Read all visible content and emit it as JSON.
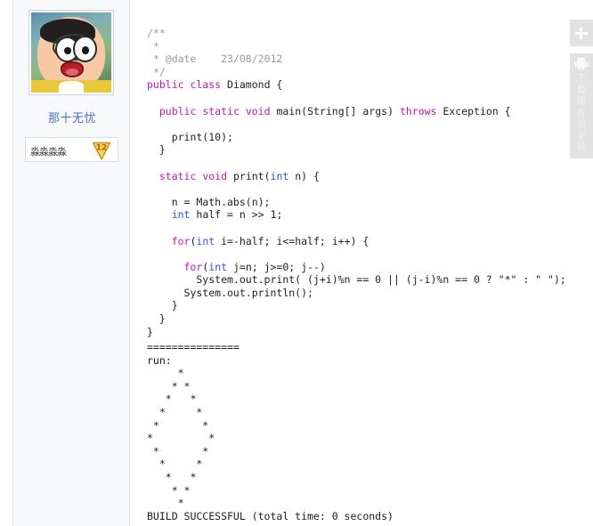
{
  "author": {
    "avatar_alt": "nobita-avatar",
    "name": "那十无忧",
    "badge_text": "淼淼淼淼",
    "badge_level": "12"
  },
  "right_rail": {
    "add_button_icon": "plus-icon",
    "app_icon": "android-robot-icon",
    "app_text_chars": [
      "下",
      "载",
      "图",
      "片",
      "到",
      "手",
      "机"
    ],
    "app_text": "下载图片到手机"
  },
  "code": {
    "language": "java",
    "lines": [
      {
        "segments": [
          {
            "t": "/**",
            "c": "cmt"
          }
        ]
      },
      {
        "segments": [
          {
            "t": " *",
            "c": "cmt"
          }
        ]
      },
      {
        "segments": [
          {
            "t": " * @date    23/08/2012",
            "c": "cmt"
          }
        ]
      },
      {
        "segments": [
          {
            "t": " */",
            "c": "cmt"
          }
        ]
      },
      {
        "segments": [
          {
            "t": "public",
            "c": "kw"
          },
          {
            "t": " ",
            "c": ""
          },
          {
            "t": "class",
            "c": "kw"
          },
          {
            "t": " Diamond {",
            "c": ""
          }
        ]
      },
      {
        "segments": [
          {
            "t": "",
            "c": ""
          }
        ]
      },
      {
        "segments": [
          {
            "t": "  ",
            "c": ""
          },
          {
            "t": "public",
            "c": "kw"
          },
          {
            "t": " ",
            "c": ""
          },
          {
            "t": "static",
            "c": "kw"
          },
          {
            "t": " ",
            "c": ""
          },
          {
            "t": "void",
            "c": "kw"
          },
          {
            "t": " main(String[] args) ",
            "c": ""
          },
          {
            "t": "throws",
            "c": "kw"
          },
          {
            "t": " Exception {",
            "c": ""
          }
        ]
      },
      {
        "segments": [
          {
            "t": "",
            "c": ""
          }
        ]
      },
      {
        "segments": [
          {
            "t": "    print(10);",
            "c": ""
          }
        ]
      },
      {
        "segments": [
          {
            "t": "  }",
            "c": ""
          }
        ]
      },
      {
        "segments": [
          {
            "t": "",
            "c": ""
          }
        ]
      },
      {
        "segments": [
          {
            "t": "  ",
            "c": ""
          },
          {
            "t": "static",
            "c": "kw"
          },
          {
            "t": " ",
            "c": ""
          },
          {
            "t": "void",
            "c": "kw"
          },
          {
            "t": " print(",
            "c": ""
          },
          {
            "t": "int",
            "c": "kw2"
          },
          {
            "t": " n) {",
            "c": ""
          }
        ]
      },
      {
        "segments": [
          {
            "t": "",
            "c": ""
          }
        ]
      },
      {
        "segments": [
          {
            "t": "    n = Math.abs(n);",
            "c": ""
          }
        ]
      },
      {
        "segments": [
          {
            "t": "    ",
            "c": ""
          },
          {
            "t": "int",
            "c": "kw2"
          },
          {
            "t": " half = n >> 1;",
            "c": ""
          }
        ]
      },
      {
        "segments": [
          {
            "t": "",
            "c": ""
          }
        ]
      },
      {
        "segments": [
          {
            "t": "    ",
            "c": ""
          },
          {
            "t": "for",
            "c": "kw"
          },
          {
            "t": "(",
            "c": ""
          },
          {
            "t": "int",
            "c": "kw2"
          },
          {
            "t": " i=-half; i<=half; i++) {",
            "c": ""
          }
        ]
      },
      {
        "segments": [
          {
            "t": "",
            "c": ""
          }
        ]
      },
      {
        "segments": [
          {
            "t": "      ",
            "c": ""
          },
          {
            "t": "for",
            "c": "kw"
          },
          {
            "t": "(",
            "c": ""
          },
          {
            "t": "int",
            "c": "kw2"
          },
          {
            "t": " j=n; j>=0; j--)",
            "c": ""
          }
        ]
      },
      {
        "segments": [
          {
            "t": "        System.out.print( (j+i)%n == 0 || (j-i)%n == 0 ? \"*\" : \" \");",
            "c": ""
          }
        ]
      },
      {
        "segments": [
          {
            "t": "      System.out.println();",
            "c": ""
          }
        ]
      },
      {
        "segments": [
          {
            "t": "    }",
            "c": ""
          }
        ]
      },
      {
        "segments": [
          {
            "t": "  }",
            "c": ""
          }
        ]
      },
      {
        "segments": [
          {
            "t": "}",
            "c": ""
          }
        ]
      }
    ]
  },
  "console": {
    "separator": "===============",
    "run_label": "run:",
    "diamond_rows": [
      "     *",
      "    * *",
      "   *   *",
      "  *     *",
      " *       *",
      "*         *",
      " *       *",
      "  *     *",
      "   *   *",
      "    * *",
      "     *"
    ],
    "build_line": "BUILD SUCCESSFUL (total time: 0 seconds)"
  },
  "colors": {
    "keyword": "#c314c3",
    "type": "#2b56d8",
    "comment": "#9a9a9a",
    "username": "#4b6fbf",
    "panel_bg": "#f8f9fb",
    "rail_bg": "#e2e2e2",
    "badge_gold": "#e8a419"
  }
}
